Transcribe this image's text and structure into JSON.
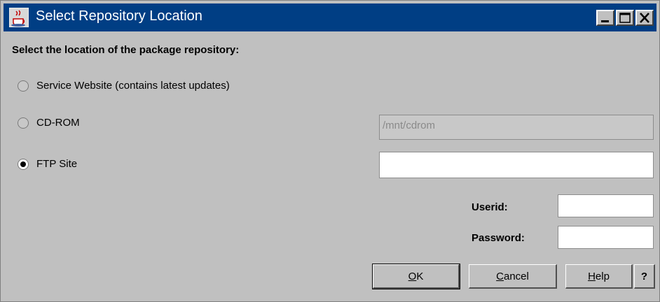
{
  "window": {
    "title": "Select Repository Location",
    "controls": {
      "minimize": "minimize-icon",
      "maximize": "maximize-icon",
      "close": "close-icon"
    }
  },
  "instruction": "Select the location of the package repository:",
  "options": [
    {
      "label": "Service Website (contains latest updates)",
      "checked": false
    },
    {
      "label": "CD-ROM",
      "checked": false
    },
    {
      "label": "FTP Site",
      "checked": true
    }
  ],
  "cdrom_path": {
    "value": "/mnt/cdrom",
    "enabled": false
  },
  "ftp_site": {
    "value": ""
  },
  "userid": {
    "label": "Userid:",
    "value": ""
  },
  "password": {
    "label": "Password:",
    "value": ""
  },
  "buttons": {
    "ok": {
      "mnemonic": "O",
      "rest": "K"
    },
    "cancel": {
      "mnemonic": "C",
      "rest": "ancel"
    },
    "help": {
      "mnemonic": "H",
      "rest": "elp"
    },
    "context_help": "?"
  }
}
